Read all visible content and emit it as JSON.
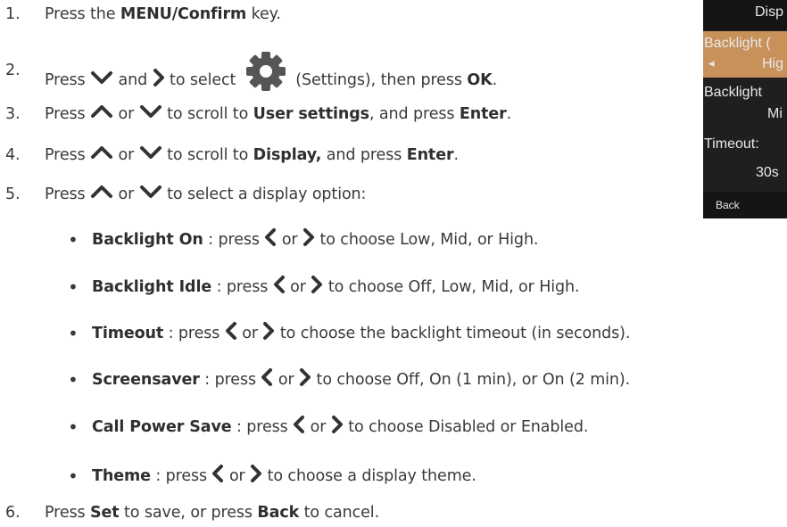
{
  "steps": [
    {
      "num": "1.",
      "pre": "Press the ",
      "key": "MENU/Confirm",
      "post": " key."
    },
    {
      "num": "2.",
      "pre": "Press ",
      "mid1": " and ",
      "mid2": " to select ",
      "mid3": " (Settings), then press ",
      "key": "OK",
      "post": "."
    },
    {
      "num": "3.",
      "pre": "Press ",
      "or": " or ",
      "mid": " to scroll to ",
      "target": "User settings",
      "mid2": ", and press ",
      "key": "Enter",
      "post": "."
    },
    {
      "num": "4.",
      "pre": "Press ",
      "or": " or ",
      "mid": " to scroll to ",
      "target": "Display,",
      "mid2": " and press ",
      "key": "Enter",
      "post": "."
    },
    {
      "num": "5.",
      "pre": "Press ",
      "or": " or ",
      "post": " to select a display option:"
    },
    {
      "num": "6.",
      "pre": "Press ",
      "key1": "Set",
      "mid": " to save, or press ",
      "key2": "Back",
      "post": " to cancel."
    }
  ],
  "options": [
    {
      "name": "Backlight On",
      "pre": " : press ",
      "or": " or ",
      "desc": " to  choose Low, Mid, or High."
    },
    {
      "name": "Backlight Idle",
      "pre": " : press ",
      "or": " or ",
      "desc": " to  choose Off, Low, Mid, or High."
    },
    {
      "name": "Timeout",
      "pre": " : press ",
      "or": " or ",
      "desc": " to  choose the backlight timeout (in seconds)."
    },
    {
      "name": "Screensaver",
      "pre": " : press ",
      "or": " or ",
      "desc": " to  choose Off, On (1 min), or On (2 min)."
    },
    {
      "name": "Call Power Save",
      "pre": " : press ",
      "or": " or ",
      "desc": " to  choose Disabled or Enabled."
    },
    {
      "name": "Theme",
      "pre": " : press ",
      "or": " or ",
      "desc": " to  choose a display theme."
    }
  ],
  "bullet": "•",
  "icons": {
    "down": "chevron-down-icon",
    "up": "chevron-up-icon",
    "left": "chevron-left-icon",
    "right": "chevron-right-icon",
    "settings": "gear-icon"
  },
  "screen": {
    "title": "Disp",
    "row1_label": "Backlight (",
    "row1_arrow": "◂",
    "row1_value": "Hig",
    "row2_label": "Backlight",
    "row2_value": "Mi",
    "row3_label": "Timeout:",
    "row3_value": "30s",
    "soft_left": "Back",
    "colors": {
      "background": "#1f1f1f",
      "highlight": "#c8915a",
      "text": "#e8e8e8"
    }
  },
  "colors": {
    "text": "#3a3a3a",
    "icon": "#333333"
  }
}
